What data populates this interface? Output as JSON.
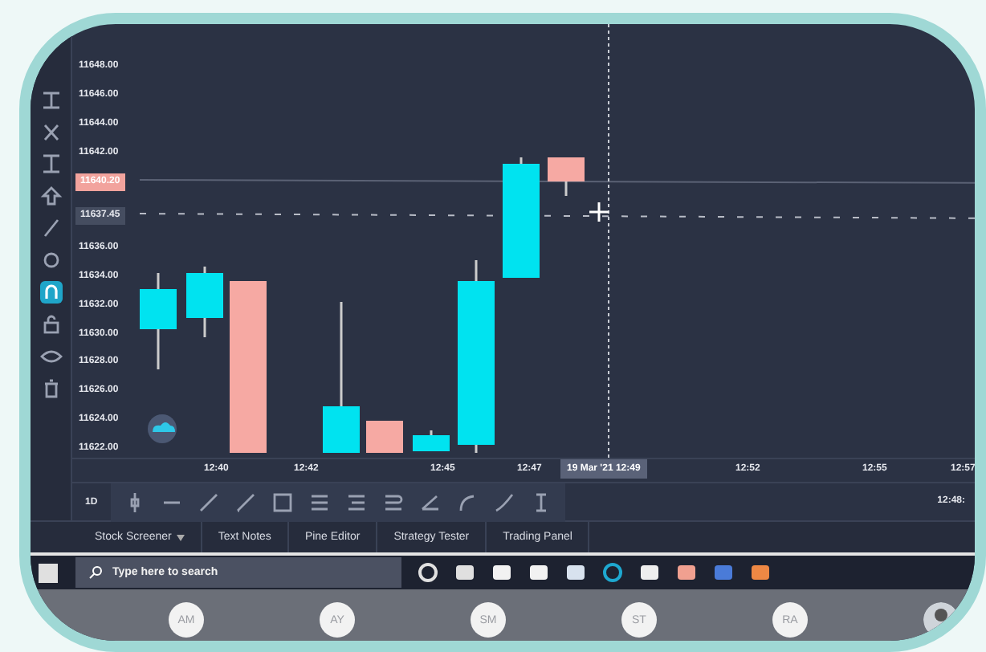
{
  "price_axis": {
    "entries": [
      {
        "kind": "tick",
        "text": "11648.00"
      },
      {
        "kind": "tick",
        "text": "11646.00"
      },
      {
        "kind": "tick",
        "text": "11644.00"
      },
      {
        "kind": "tick",
        "text": "11642.00"
      },
      {
        "kind": "last",
        "text": "11640.20"
      },
      {
        "kind": "cursor",
        "text": "11637.45"
      },
      {
        "kind": "tick",
        "text": "11636.00"
      },
      {
        "kind": "tick",
        "text": "11634.00"
      },
      {
        "kind": "tick",
        "text": "11632.00"
      },
      {
        "kind": "tick",
        "text": "11630.00"
      },
      {
        "kind": "tick",
        "text": "11628.00"
      },
      {
        "kind": "tick",
        "text": "11626.00"
      },
      {
        "kind": "tick",
        "text": "11624.00"
      },
      {
        "kind": "tick",
        "text": "11622.00"
      }
    ]
  },
  "time_axis": {
    "labels": [
      "12:40",
      "12:42",
      "12:45",
      "12:47",
      "12:52",
      "12:55",
      "12:57"
    ],
    "cursor_label": "19 Mar '21   12:49"
  },
  "interval": "1D",
  "clock": "12:48:",
  "bottom_tabs": [
    {
      "label": "Stock Screener",
      "dropdown": true
    },
    {
      "label": "Text Notes",
      "dropdown": false
    },
    {
      "label": "Pine Editor",
      "dropdown": false
    },
    {
      "label": "Strategy Tester",
      "dropdown": false
    },
    {
      "label": "Trading Panel",
      "dropdown": false
    }
  ],
  "taskbar": {
    "search": {
      "placeholder": "Type here to search"
    }
  },
  "participants": [
    {
      "kind": "initials",
      "text": "AM"
    },
    {
      "kind": "initials",
      "text": "AY"
    },
    {
      "kind": "initials",
      "text": "SM"
    },
    {
      "kind": "initials",
      "text": "ST"
    },
    {
      "kind": "initials",
      "text": "RA"
    },
    {
      "kind": "picture"
    }
  ]
}
